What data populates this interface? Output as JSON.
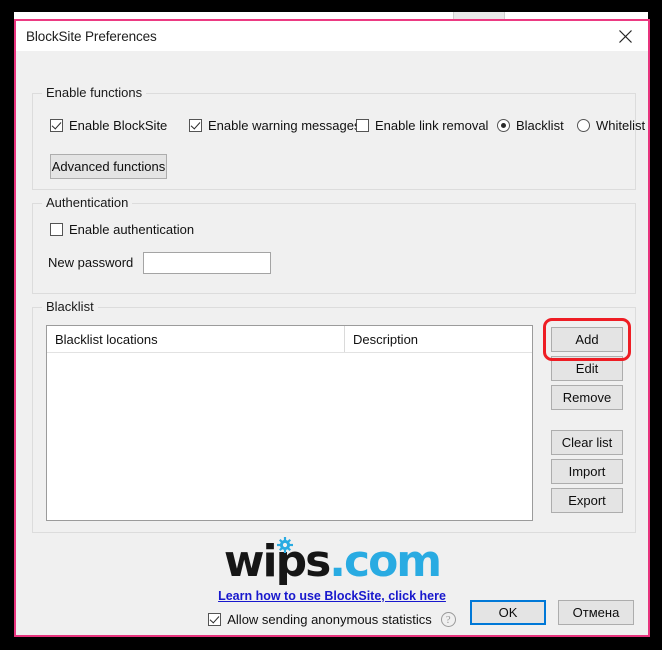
{
  "window": {
    "title": "BlockSite Preferences",
    "close_icon": "close-icon",
    "border_color": "#e8347e"
  },
  "enable_functions": {
    "legend": "Enable functions",
    "checkboxes": [
      {
        "label": "Enable BlockSite",
        "checked": true
      },
      {
        "label": "Enable warning messages",
        "checked": true
      },
      {
        "label": "Enable link removal",
        "checked": false
      }
    ],
    "radios": [
      {
        "label": "Blacklist",
        "selected": true
      },
      {
        "label": "Whitelist",
        "selected": false
      }
    ],
    "advanced_button": "Advanced functions"
  },
  "authentication": {
    "legend": "Authentication",
    "enable_label": "Enable authentication",
    "enable_checked": false,
    "password_label": "New password",
    "password_value": "",
    "password_placeholder": ""
  },
  "blacklist": {
    "legend": "Blacklist",
    "columns": [
      "Blacklist locations",
      "Description"
    ],
    "rows": [],
    "buttons": [
      {
        "id": "add",
        "label": "Add",
        "highlighted": true
      },
      {
        "id": "edit",
        "label": "Edit",
        "highlighted": false
      },
      {
        "id": "remove",
        "label": "Remove",
        "highlighted": false
      },
      {
        "id": "clear",
        "label": "Clear list",
        "highlighted": false
      },
      {
        "id": "import",
        "label": "Import",
        "highlighted": false
      },
      {
        "id": "export",
        "label": "Export",
        "highlighted": false
      }
    ],
    "highlight_color": "#ee1d24"
  },
  "branding": {
    "logo_main": "wips",
    "logo_dot": ".",
    "logo_tld": "com",
    "logo_accent": "#29abe2",
    "gear_icon": "gear-icon",
    "link_text": "Learn how to use BlockSite, click here",
    "link_color": "#1818cd",
    "stats_label": "Allow sending anonymous statistics",
    "stats_checked": true,
    "help_icon": "?"
  },
  "footer": {
    "ok_label": "OK",
    "cancel_label": "Отмена",
    "focus_color": "#0078d7"
  }
}
